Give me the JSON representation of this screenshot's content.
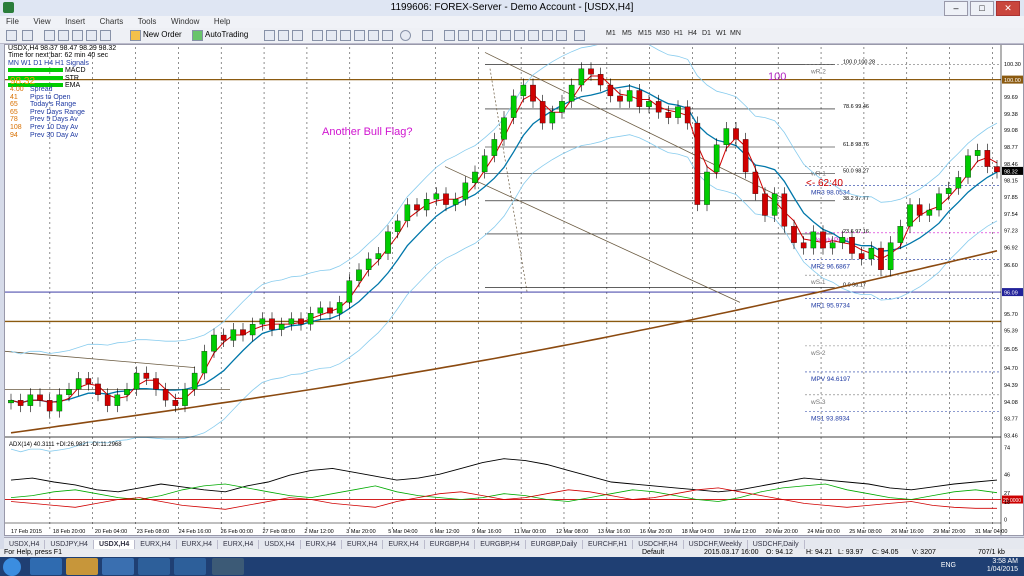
{
  "window": {
    "title": "1199606: FOREX-Server - Demo Account - [USDX,H4]"
  },
  "menu": [
    "File",
    "View",
    "Insert",
    "Charts",
    "Tools",
    "Window",
    "Help"
  ],
  "toolbar": {
    "new_order": "New Order",
    "autotrading": "AutoTrading",
    "timeframes": [
      "M1",
      "M5",
      "M15",
      "M30",
      "H1",
      "H4",
      "D1",
      "W1",
      "MN"
    ]
  },
  "chart_info": {
    "header": "USDX,H4  98.37 98.47 98.29 98.32",
    "countdown": "Time for next bar: 62 min 40 sec",
    "signal_header": "MN  W1  D1  H4  H1  Signals",
    "legend": [
      "MACD",
      "STR",
      "EMA"
    ],
    "price_big": "98.32"
  },
  "stats": [
    {
      "num": "4.00",
      "label": "Spread"
    },
    {
      "num": "41",
      "label": "Pips to Open"
    },
    {
      "num": "65",
      "label": "Today's Range"
    },
    {
      "num": "65",
      "label": "Prev Days Range"
    },
    {
      "num": "78",
      "label": "Prev 5 Days Av"
    },
    {
      "num": "108",
      "label": "Prev 10 Day Av"
    },
    {
      "num": "94",
      "label": "Prev 30 Day Av"
    }
  ],
  "annotations": {
    "bull_flag": "Another Bull Flag?",
    "level_100": "100",
    "countdown_on_chart": "<- 62:40"
  },
  "fib_levels": [
    {
      "label": "100.0  100.28",
      "price": 100.28
    },
    {
      "label": "78.6  99.46",
      "price": 99.46
    },
    {
      "label": "61.8  98.76",
      "price": 98.76
    },
    {
      "label": "50.0  98.27",
      "price": 98.27
    },
    {
      "label": "38.2  97.77",
      "price": 97.77
    },
    {
      "label": "23.6  97.16",
      "price": 97.16
    },
    {
      "label": "0.0  96.17",
      "price": 96.17
    }
  ],
  "pivot_labels": [
    {
      "label": "wR 2",
      "price": 100.28,
      "color": "#777777"
    },
    {
      "label": "wR 1",
      "price": 98.4,
      "color": "#777777"
    },
    {
      "label": "MR3  98.0534",
      "price": 98.05,
      "color": "#1f3aa3"
    },
    {
      "label": "Weekly Pivot",
      "price": 97.18,
      "color": "#d015d0"
    },
    {
      "label": "MR2  96.6867",
      "price": 96.69,
      "color": "#1f3aa3"
    },
    {
      "label": "wS 1",
      "price": 96.4,
      "color": "#777777"
    },
    {
      "label": "MR1  95.9734",
      "price": 95.97,
      "color": "#1f3aa3"
    },
    {
      "label": "wS 2",
      "price": 95.1,
      "color": "#777777"
    },
    {
      "label": "MPV  94.6197",
      "price": 94.62,
      "color": "#1f3aa3"
    },
    {
      "label": "wS 3",
      "price": 94.2,
      "color": "#777777"
    },
    {
      "label": "MS1  93.8934",
      "price": 93.89,
      "color": "#1f3aa3"
    }
  ],
  "price_axis": [
    "100.30",
    "100.00",
    "99.69",
    "99.38",
    "99.08",
    "98.77",
    "98.46",
    "98.32",
    "98.15",
    "97.85",
    "97.54",
    "97.23",
    "96.92",
    "96.60",
    "96.09",
    "95.70",
    "95.39",
    "95.05",
    "94.70",
    "94.39",
    "94.08",
    "93.77",
    "93.46"
  ],
  "time_axis": [
    "17 Feb 2015",
    "18 Feb 20:00",
    "20 Feb 04:00",
    "23 Feb 08:00",
    "24 Feb 16:00",
    "26 Feb 00:00",
    "27 Feb 08:00",
    "2 Mar 12:00",
    "3 Mar 20:00",
    "5 Mar 04:00",
    "6 Mar 12:00",
    "9 Mar 16:00",
    "11 Mar 00:00",
    "12 Mar 08:00",
    "13 Mar 16:00",
    "16 Mar 20:00",
    "18 Mar 04:00",
    "19 Mar 12:00",
    "20 Mar 20:00",
    "24 Mar 00:00",
    "25 Mar 08:00",
    "26 Mar 16:00",
    "29 Mar 20:00",
    "31 Mar 04:00"
  ],
  "adx_label": "ADX(14) 40.3111 +DI:26.9821 -DI:11.2968",
  "adx_axis": [
    "74",
    "46",
    "27",
    "20.0000",
    "18",
    "0"
  ],
  "tabs": [
    "USDX,H4",
    "USDJPY,H4",
    "USDX,H4",
    "EURX,H4",
    "EURX,H4",
    "EURX,H4",
    "USDX,H4",
    "EURX,H4",
    "EURX,H4",
    "EURX,H4",
    "EURGBP,H4",
    "EURGBP,H4",
    "EURGBP,Daily",
    "EURCHF,H1",
    "USDCHF,H4",
    "USDCHF,Weekly",
    "USDCHF,Daily"
  ],
  "active_tab_index": 2,
  "status": {
    "help": "For Help, press F1",
    "profile": "Default",
    "time": "2015.03.17 16:00",
    "o": "O: 94.12",
    "h": "H: 94.21",
    "l": "L: 93.97",
    "c": "C: 94.05",
    "v": "V: 3207",
    "kb": "707/1 kb"
  },
  "taskbar": {
    "lang": "ENG",
    "time": "3:58 AM",
    "date": "1/04/2015"
  },
  "colors": {
    "bull": "#00cc00",
    "bear": "#d00000",
    "ema_fast": "#d00000",
    "ema_mid": "#0077aa",
    "ma_slow": "#8b4a10",
    "bb": "#88ccee",
    "orange_line": "#8b5a10"
  },
  "chart_data": {
    "type": "candlestick",
    "symbol": "USDX",
    "timeframe": "H4",
    "ylim": [
      93.46,
      100.6
    ],
    "close_path": [
      94.1,
      94.0,
      94.2,
      94.1,
      93.9,
      94.2,
      94.3,
      94.5,
      94.4,
      94.2,
      94.0,
      94.2,
      94.3,
      94.6,
      94.5,
      94.3,
      94.1,
      94.0,
      94.3,
      94.6,
      95.0,
      95.3,
      95.2,
      95.4,
      95.3,
      95.5,
      95.6,
      95.4,
      95.5,
      95.6,
      95.5,
      95.7,
      95.8,
      95.7,
      95.9,
      96.3,
      96.5,
      96.7,
      96.8,
      97.2,
      97.4,
      97.7,
      97.6,
      97.8,
      97.9,
      97.7,
      97.8,
      98.1,
      98.3,
      98.6,
      98.9,
      99.3,
      99.7,
      99.9,
      99.6,
      99.2,
      99.4,
      99.6,
      99.9,
      100.2,
      100.1,
      99.9,
      99.7,
      99.6,
      99.8,
      99.5,
      99.6,
      99.4,
      99.3,
      99.5,
      99.2,
      97.7,
      98.3,
      98.8,
      99.1,
      98.9,
      98.3,
      97.9,
      97.5,
      97.9,
      97.3,
      97.0,
      96.9,
      97.2,
      96.9,
      97.0,
      97.1,
      96.8,
      96.7,
      96.9,
      96.5,
      97.0,
      97.3,
      97.7,
      97.5,
      97.6,
      97.9,
      98.0,
      98.2,
      98.6,
      98.7,
      98.4,
      98.3
    ],
    "adx": [
      40,
      42,
      38,
      35,
      30,
      28,
      32,
      36,
      33,
      30,
      28,
      34,
      38,
      45,
      50,
      52,
      48,
      44,
      40,
      42,
      46,
      52,
      58,
      62,
      60,
      56,
      50,
      44,
      38,
      36,
      34,
      32,
      30,
      28,
      30,
      34,
      38,
      42,
      40,
      38,
      36,
      32,
      30,
      33,
      36,
      38,
      40
    ],
    "plus_di": [
      22,
      24,
      28,
      30,
      26,
      22,
      20,
      24,
      30,
      34,
      36,
      32,
      28,
      24,
      22,
      26,
      30,
      34,
      28,
      24,
      22,
      20,
      22,
      26,
      24,
      20,
      18,
      22,
      26,
      30,
      28,
      24,
      20,
      18,
      22,
      28,
      32,
      34,
      36,
      30,
      26,
      22,
      20,
      24,
      28,
      30,
      27
    ],
    "minus_di": [
      18,
      16,
      14,
      12,
      16,
      20,
      22,
      18,
      14,
      12,
      10,
      14,
      18,
      22,
      20,
      16,
      14,
      12,
      18,
      22,
      26,
      28,
      24,
      20,
      22,
      26,
      30,
      28,
      24,
      20,
      22,
      26,
      30,
      32,
      28,
      24,
      20,
      16,
      14,
      12,
      14,
      16,
      18,
      14,
      12,
      11,
      11
    ]
  }
}
